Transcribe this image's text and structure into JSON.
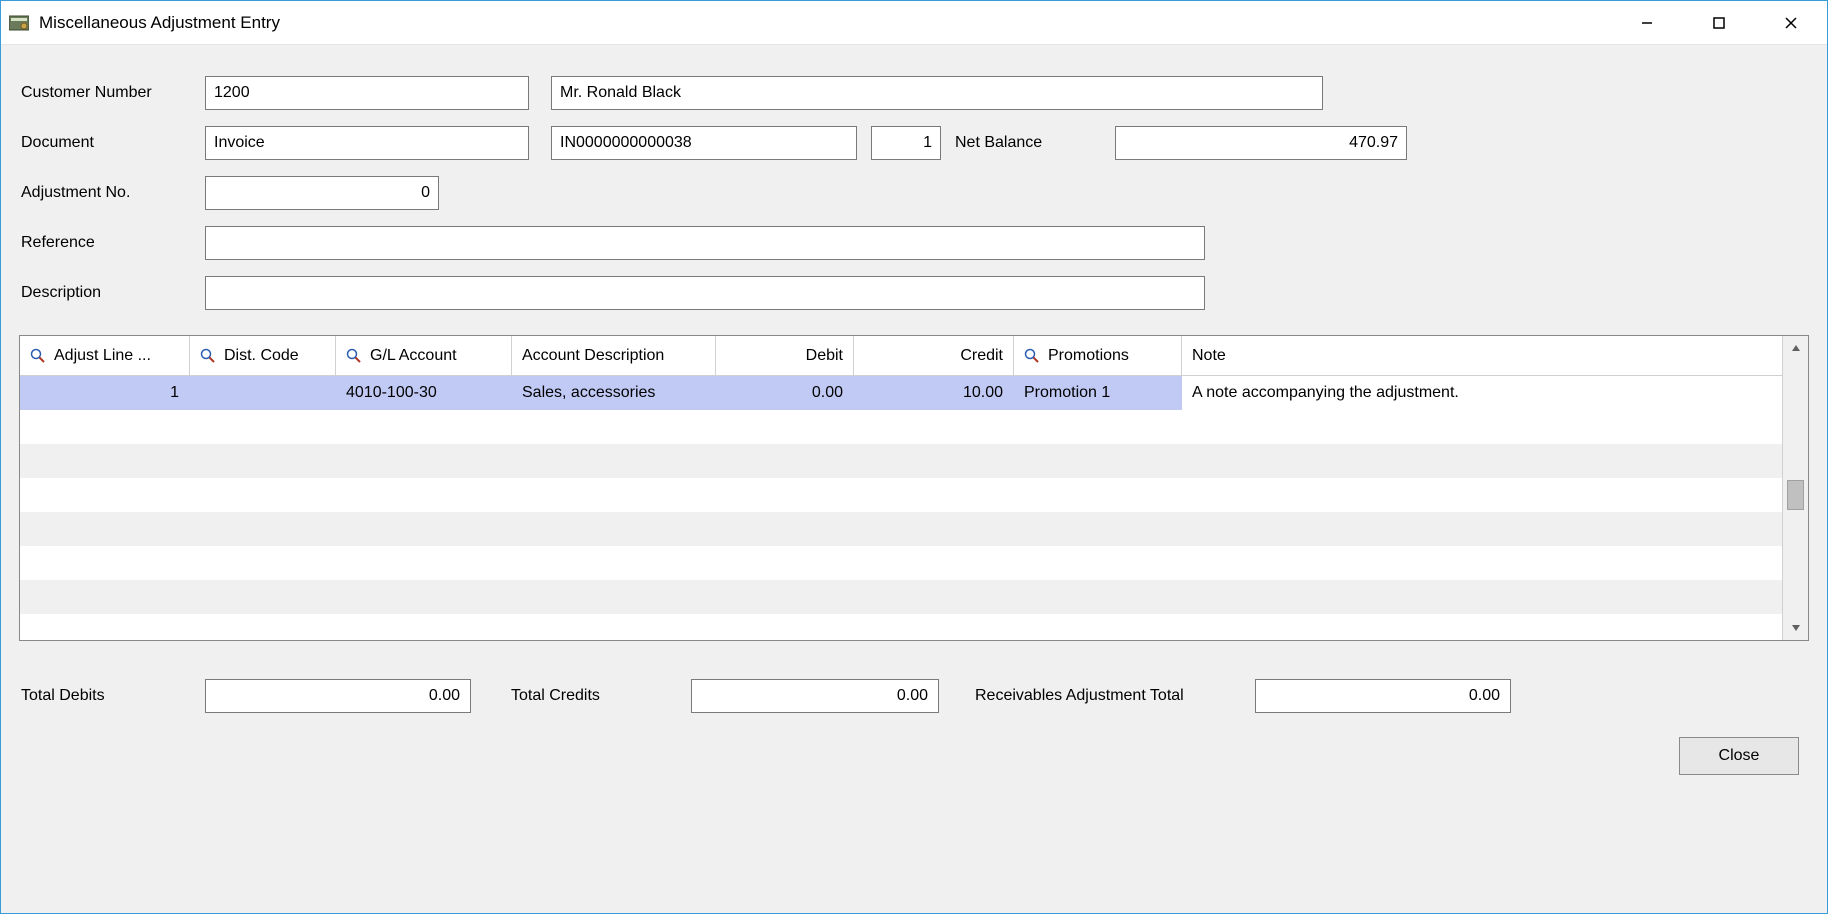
{
  "window": {
    "title": "Miscellaneous Adjustment Entry"
  },
  "form": {
    "customerNumber": {
      "label": "Customer Number",
      "value": "1200",
      "name": "Mr. Ronald Black"
    },
    "document": {
      "label": "Document",
      "type": "Invoice",
      "number": "IN0000000000038",
      "seq": "1"
    },
    "netBalance": {
      "label": "Net Balance",
      "value": "470.97"
    },
    "adjustmentNo": {
      "label": "Adjustment No.",
      "value": "0"
    },
    "reference": {
      "label": "Reference",
      "value": ""
    },
    "description": {
      "label": "Description",
      "value": ""
    }
  },
  "grid": {
    "headers": {
      "adjustLine": "Adjust Line ...",
      "distCode": "Dist. Code",
      "glAccount": "G/L Account",
      "accountDesc": "Account Description",
      "debit": "Debit",
      "credit": "Credit",
      "promotions": "Promotions",
      "note": "Note"
    },
    "rows": [
      {
        "adjustLine": "1",
        "distCode": "",
        "glAccount": "4010-100-30",
        "accountDesc": "Sales, accessories",
        "debit": "0.00",
        "credit": "10.00",
        "promotions": "Promotion 1",
        "note": "A note accompanying the adjustment."
      }
    ]
  },
  "totals": {
    "totalDebits": {
      "label": "Total Debits",
      "value": "0.00"
    },
    "totalCredits": {
      "label": "Total Credits",
      "value": "0.00"
    },
    "receivablesAdjTotal": {
      "label": "Receivables Adjustment Total",
      "value": "0.00"
    }
  },
  "buttons": {
    "close": "Close"
  }
}
